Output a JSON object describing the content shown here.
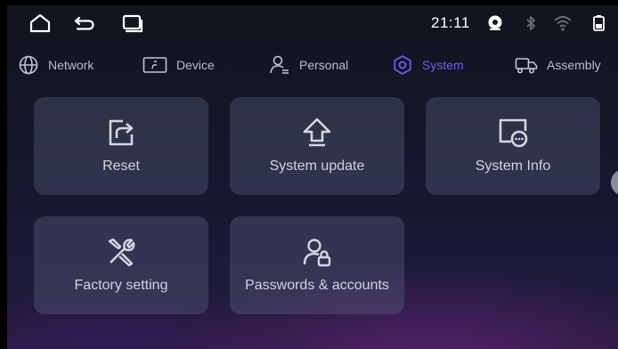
{
  "status_bar": {
    "time": "21:11",
    "nav_icons": [
      "home-icon",
      "back-icon",
      "recent-apps-icon"
    ],
    "status_icons": [
      "location-icon",
      "bluetooth-icon",
      "wifi-icon",
      "battery-icon"
    ]
  },
  "tabs": [
    {
      "label": "Network",
      "icon": "globe-icon",
      "active": false
    },
    {
      "label": "Device",
      "icon": "display-icon",
      "active": false
    },
    {
      "label": "Personal",
      "icon": "person-icon",
      "active": false
    },
    {
      "label": "System",
      "icon": "gear-icon",
      "active": true
    },
    {
      "label": "Assembly",
      "icon": "truck-icon",
      "active": false
    }
  ],
  "cards": [
    {
      "label": "Reset",
      "icon": "reset-icon"
    },
    {
      "label": "System update",
      "icon": "upload-arrow-icon"
    },
    {
      "label": "System Info",
      "icon": "info-monitor-icon"
    },
    {
      "label": "Factory setting",
      "icon": "tools-icon"
    },
    {
      "label": "Passwords & accounts",
      "icon": "user-lock-icon"
    }
  ],
  "colors": {
    "accent": "#6f5cf0",
    "text": "#c7cbd6",
    "card_bg": "#3a3e54"
  }
}
